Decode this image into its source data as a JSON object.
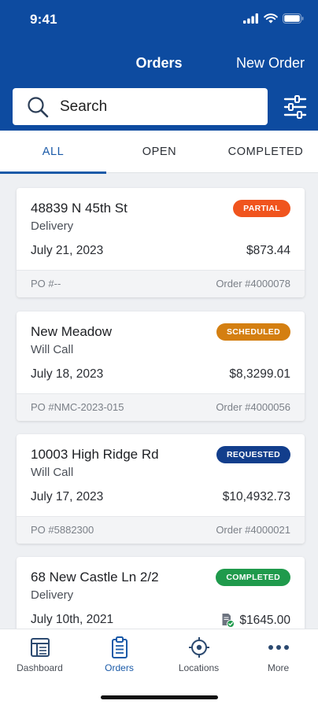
{
  "status_bar": {
    "time": "9:41"
  },
  "header": {
    "title": "Orders",
    "new_order_label": "New Order"
  },
  "search": {
    "placeholder": "Search"
  },
  "tabs": [
    {
      "label": "ALL",
      "active": true
    },
    {
      "label": "OPEN",
      "active": false
    },
    {
      "label": "COMPLETED",
      "active": false
    }
  ],
  "orders": [
    {
      "address": "48839 N 45th St",
      "type": "Delivery",
      "status": "PARTIAL",
      "status_color": "#f0541e",
      "date": "July 21, 2023",
      "amount": "$873.44",
      "po": "PO #--",
      "order_number": "Order #4000078"
    },
    {
      "address": "New Meadow",
      "type": "Will Call",
      "status": "SCHEDULED",
      "status_color": "#d47f11",
      "date": "July 18, 2023",
      "amount": "$8,3299.01",
      "po": "PO #NMC-2023-015",
      "order_number": "Order #4000056"
    },
    {
      "address": "10003 High Ridge Rd",
      "type": "Will Call",
      "status": "REQUESTED",
      "status_color": "#123e8c",
      "date": "July 17, 2023",
      "amount": "$10,4932.73",
      "po": "PO #5882300",
      "order_number": "Order #4000021"
    },
    {
      "address": "68 New Castle Ln 2/2",
      "type": "Delivery",
      "status": "COMPLETED",
      "status_color": "#1f9a4c",
      "date": "July 10th, 2021",
      "amount": "$1645.00",
      "po": "",
      "order_number": ""
    }
  ],
  "bottom_nav": [
    {
      "label": "Dashboard",
      "icon": "dashboard-icon",
      "active": false
    },
    {
      "label": "Orders",
      "icon": "clipboard-icon",
      "active": true
    },
    {
      "label": "Locations",
      "icon": "crosshair-icon",
      "active": false
    },
    {
      "label": "More",
      "icon": "more-icon",
      "active": false
    }
  ],
  "colors": {
    "brand": "#0d4ba0",
    "accent": "#1a5aa8"
  }
}
